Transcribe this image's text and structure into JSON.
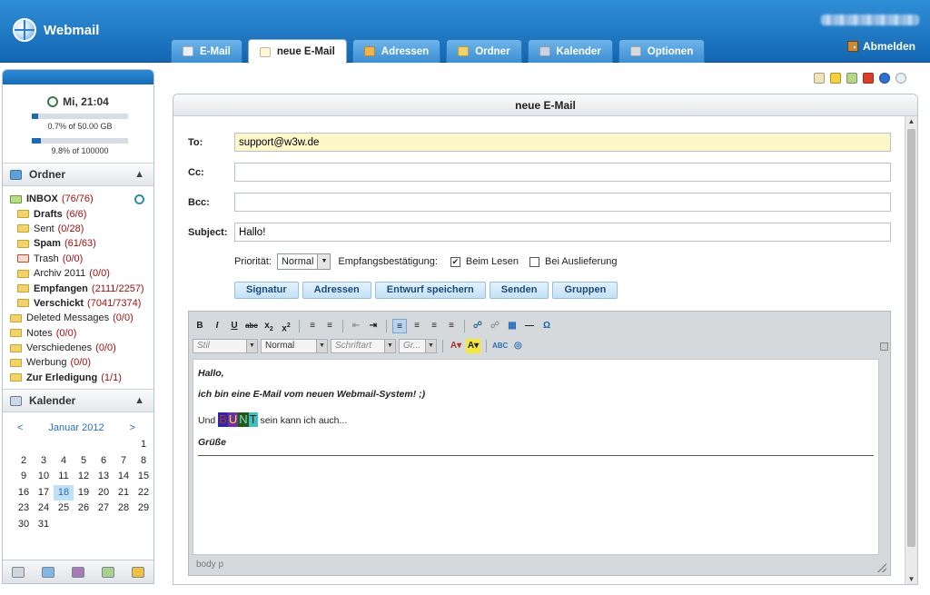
{
  "app": {
    "title": "Webmail",
    "logout": "Abmelden"
  },
  "tabs": [
    {
      "label": "E-Mail",
      "icon": "mail-icon",
      "color": "#e9f0f8"
    },
    {
      "label": "neue E-Mail",
      "icon": "compose-icon",
      "color": "#fff7d6",
      "active": true
    },
    {
      "label": "Adressen",
      "icon": "addressbook-icon",
      "color": "#f0b44a"
    },
    {
      "label": "Ordner",
      "icon": "folder-icon",
      "color": "#f2d36b"
    },
    {
      "label": "Kalender",
      "icon": "calendar-icon",
      "color": "#c8d3e6"
    },
    {
      "label": "Optionen",
      "icon": "gear-icon",
      "color": "#d6dbe0"
    }
  ],
  "sidebar": {
    "clock": "Mi, 21:04",
    "quota_storage": {
      "text": "0.7% of 50.00 GB",
      "fraction": 0.07
    },
    "quota_messages": {
      "text": "9.8% of 100000",
      "fraction": 0.098
    },
    "folders_title": "Ordner",
    "folders": [
      {
        "name": "INBOX",
        "count": "(76/76)",
        "bold": true,
        "indent": 0
      },
      {
        "name": "Drafts",
        "count": "(6/6)",
        "bold": true,
        "indent": 1
      },
      {
        "name": "Sent",
        "count": "(0/28)",
        "bold": false,
        "indent": 1
      },
      {
        "name": "Spam",
        "count": "(61/63)",
        "bold": true,
        "indent": 1
      },
      {
        "name": "Trash",
        "count": "(0/0)",
        "bold": false,
        "indent": 1
      },
      {
        "name": "Archiv 2011",
        "count": "(0/0)",
        "bold": false,
        "indent": 1
      },
      {
        "name": "Empfangen",
        "count": "(2111/2257)",
        "bold": true,
        "indent": 1
      },
      {
        "name": "Verschickt",
        "count": "(7041/7374)",
        "bold": true,
        "indent": 1
      },
      {
        "name": "Deleted Messages",
        "count": "(0/0)",
        "bold": false,
        "indent": 0
      },
      {
        "name": "Notes",
        "count": "(0/0)",
        "bold": false,
        "indent": 0
      },
      {
        "name": "Verschiedenes",
        "count": "(0/0)",
        "bold": false,
        "indent": 0
      },
      {
        "name": "Werbung",
        "count": "(0/0)",
        "bold": false,
        "indent": 0
      },
      {
        "name": "Zur Erledigung",
        "count": "(1/1)",
        "bold": true,
        "indent": 0
      }
    ],
    "calendar_title": "Kalender",
    "calendar": {
      "month": "Januar 2012",
      "prev": "<",
      "next": ">",
      "today": "18",
      "days": [
        "",
        "",
        "",
        "",
        "",
        "",
        "1",
        "2",
        "3",
        "4",
        "5",
        "6",
        "7",
        "8",
        "9",
        "10",
        "11",
        "12",
        "13",
        "14",
        "15",
        "16",
        "17",
        "18",
        "19",
        "20",
        "21",
        "22",
        "23",
        "24",
        "25",
        "26",
        "27",
        "28",
        "29",
        "30",
        "31"
      ]
    }
  },
  "compose": {
    "title": "neue E-Mail",
    "to_label": "To:",
    "to_value": "support@w3w.de",
    "cc_label": "Cc:",
    "cc_value": "",
    "bcc_label": "Bcc:",
    "bcc_value": "",
    "subject_label": "Subject:",
    "subject_value": "Hallo!",
    "priority_label": "Priorität:",
    "priority_value": "Normal",
    "receipt_label": "Empfangsbestätigung:",
    "receipt_read": "Beim Lesen",
    "receipt_read_checked": true,
    "receipt_delivery": "Bei Auslieferung",
    "receipt_delivery_checked": false,
    "buttons": [
      "Signatur",
      "Adressen",
      "Entwurf speichern",
      "Senden",
      "Gruppen"
    ]
  },
  "editor": {
    "style_placeholder": "Stil",
    "format_value": "Normal",
    "font_placeholder": "Schriftart",
    "size_placeholder": "Gr...",
    "body": {
      "line1": "Hallo,",
      "line2": "ich bin eine E-Mail vom neuen Webmail-System! ;)",
      "line3_pre": "Und",
      "bunt": [
        {
          "ch": "B",
          "bg": "#2a2aa8",
          "fg": "#b03030"
        },
        {
          "ch": "U",
          "bg": "#7030a0",
          "fg": "#f2e030"
        },
        {
          "ch": "N",
          "bg": "#1e5a1e",
          "fg": "#8fd8c8"
        },
        {
          "ch": "T",
          "bg": "#40c0c0",
          "fg": "#1a1a1a"
        }
      ],
      "line3_post": "sein kann ich auch...",
      "line4": "Grüße"
    },
    "statusbar": "body  p"
  }
}
